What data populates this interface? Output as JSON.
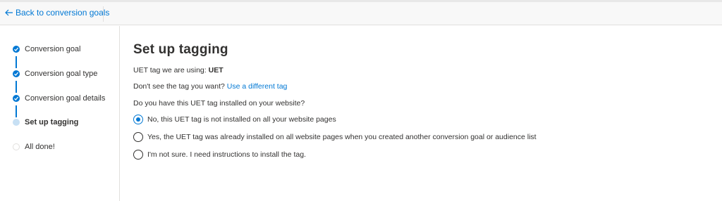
{
  "header": {
    "back_label": "Back to conversion goals"
  },
  "sidebar": {
    "steps": [
      {
        "label": "Conversion goal",
        "state": "done"
      },
      {
        "label": "Conversion goal type",
        "state": "done"
      },
      {
        "label": "Conversion goal details",
        "state": "done"
      },
      {
        "label": "Set up tagging",
        "state": "current"
      },
      {
        "label": "All done!",
        "state": "todo"
      }
    ]
  },
  "main": {
    "title": "Set up tagging",
    "uet_prefix": "UET tag we are using:",
    "uet_value": "UET",
    "dont_see_prefix": "Don't see the tag you want?",
    "dont_see_link": "Use a different tag",
    "question": "Do you have this UET tag installed on your website?",
    "options": [
      {
        "label": "No, this UET tag is not installed on all your website pages",
        "checked": true
      },
      {
        "label": "Yes, the UET tag was already installed on all website pages when you created another conversion goal or audience list",
        "checked": false
      },
      {
        "label": "I'm not sure. I need instructions to install the tag.",
        "checked": false
      }
    ]
  },
  "colors": {
    "accent": "#0078d4",
    "current_step": "#c7e0f4"
  }
}
